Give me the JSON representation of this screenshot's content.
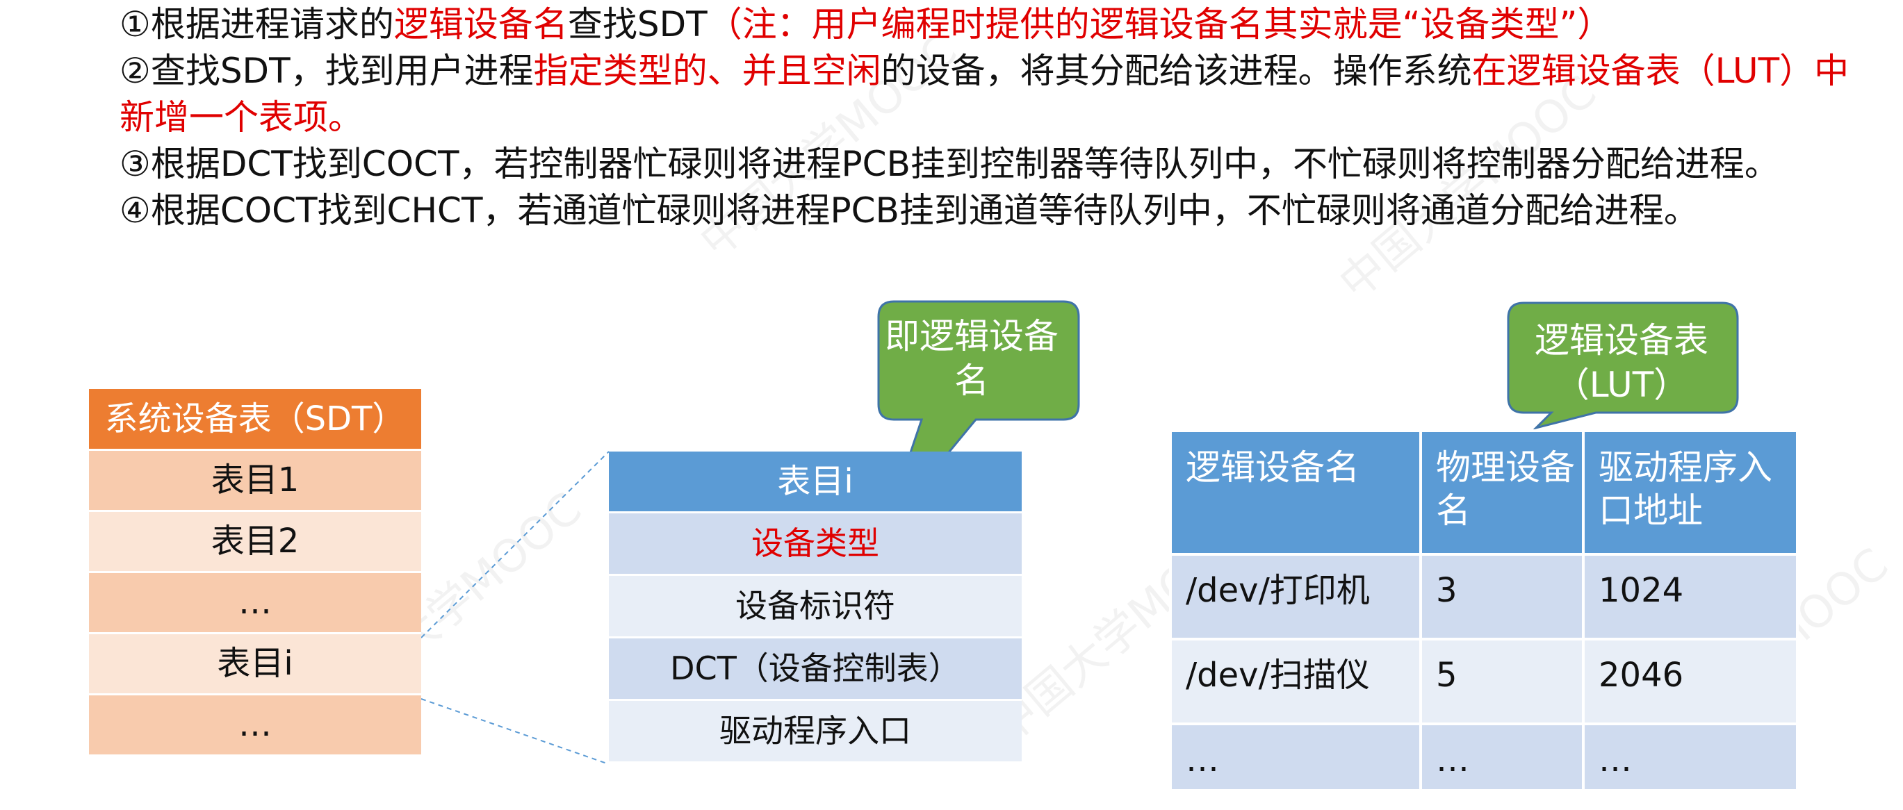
{
  "steps": [
    {
      "parts": [
        {
          "text": "①根据进程请求的"
        },
        {
          "text": "逻辑设备名",
          "red": true
        },
        {
          "text": "查找SDT"
        },
        {
          "text": "（注：用户编程时提供的逻辑设备名其实就是“设备类型”）",
          "red": true
        }
      ]
    },
    {
      "parts": [
        {
          "text": "②查找SDT，找到用户进程"
        },
        {
          "text": "指定类型的、并且空闲",
          "red": true
        },
        {
          "text": "的设备，将其分配给该进程。操作系统"
        },
        {
          "text": "在逻辑设备表（LUT）中新增一个表项。",
          "red": true
        }
      ]
    },
    {
      "parts": [
        {
          "text": "③根据DCT找到COCT，若控制器忙碌则将进程PCB挂到控制器等待队列中，不忙碌则将控制器分配给进程。"
        }
      ]
    },
    {
      "parts": [
        {
          "text": "④根据COCT找到CHCT，若通道忙碌则将进程PCB挂到通道等待队列中，不忙碌则将通道分配给进程。"
        }
      ]
    }
  ],
  "sdt": {
    "title": "系统设备表（SDT）",
    "rows": [
      "表目1",
      "表目2",
      "…",
      "表目i",
      "…"
    ]
  },
  "entry": {
    "title": "表目i",
    "rows": [
      "设备类型",
      "设备标识符",
      "DCT（设备控制表）",
      "驱动程序入口"
    ]
  },
  "lut": {
    "headers": [
      "逻辑设备名",
      "物理设备名",
      "驱动程序入口地址"
    ],
    "rows": [
      [
        "/dev/打印机",
        "3",
        "1024"
      ],
      [
        "/dev/扫描仪",
        "5",
        "2046"
      ],
      [
        "…",
        "…",
        "…"
      ]
    ]
  },
  "callouts": {
    "logical_name": "即逻辑设备名",
    "lut": "逻辑设备表（LUT）"
  },
  "colors": {
    "highlight": "#e00000",
    "sdt_header": "#ed7d31",
    "table_header": "#5b9bd5",
    "callout_fill": "#70ad47"
  }
}
